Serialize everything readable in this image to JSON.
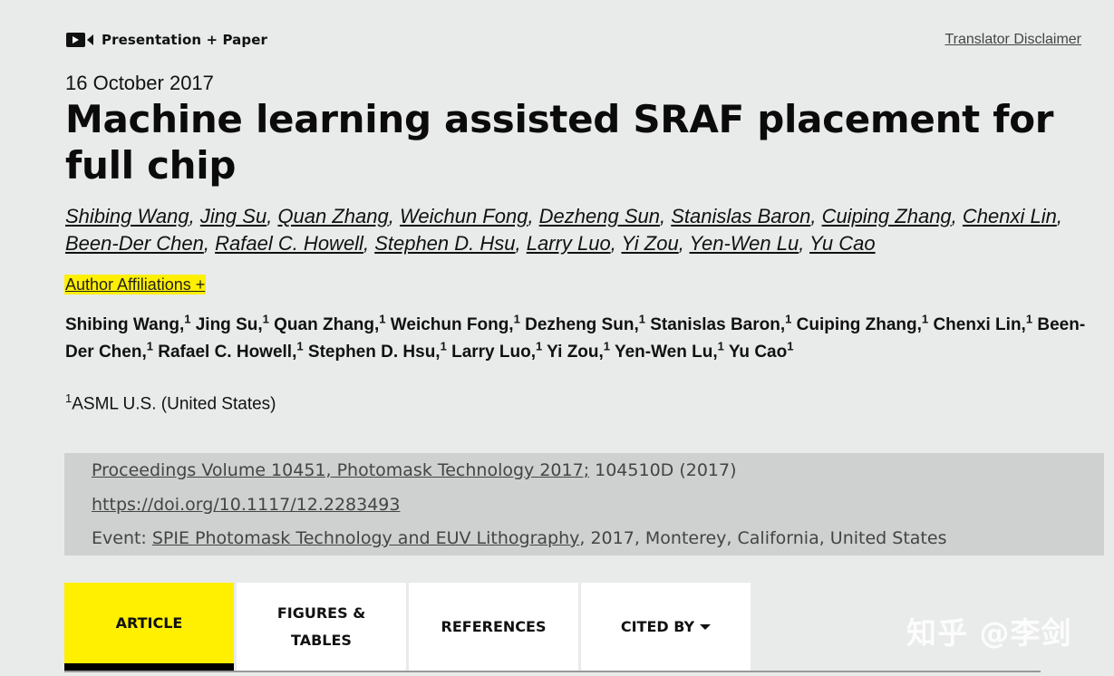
{
  "header": {
    "badge_label": "Presentation + Paper",
    "badge_icon": "video-camera-icon",
    "disclaimer_link": "Translator Disclaimer"
  },
  "paper": {
    "date": "16 October 2017",
    "title": "Machine learning assisted SRAF placement for full chip",
    "authors": [
      "Shibing Wang",
      "Jing Su",
      "Quan Zhang",
      "Weichun Fong",
      "Dezheng Sun",
      "Stanislas Baron",
      "Cuiping Zhang",
      "Chenxi Lin",
      "Been-Der Chen",
      "Rafael C. Howell",
      "Stephen D. Hsu",
      "Larry Luo",
      "Yi Zou",
      "Yen-Wen Lu",
      "Yu Cao"
    ],
    "affiliations_toggle": "Author Affiliations +",
    "affiliation_marker": "1",
    "affiliation": "ASML U.S. (United States)"
  },
  "publication": {
    "proceedings_link": "Proceedings Volume 10451, Photomask Technology 2017;",
    "article_number": " 104510D (2017)",
    "doi_link": "https://doi.org/10.1117/12.2283493",
    "event_prefix": "Event: ",
    "event_link": "SPIE Photomask Technology and EUV Lithography",
    "event_suffix": ", 2017, Monterey, California, United States"
  },
  "tabs": [
    {
      "label": "ARTICLE",
      "active": true
    },
    {
      "label": "FIGURES &\nTABLES",
      "active": false
    },
    {
      "label": "REFERENCES",
      "active": false
    },
    {
      "label": "CITED BY",
      "active": false,
      "has_dropdown": true
    }
  ],
  "watermark": "知乎 @李剑",
  "colors": {
    "accent_yellow": "#ffef00",
    "background": "#e9eaea",
    "pub_box": "#cfd0d0"
  }
}
